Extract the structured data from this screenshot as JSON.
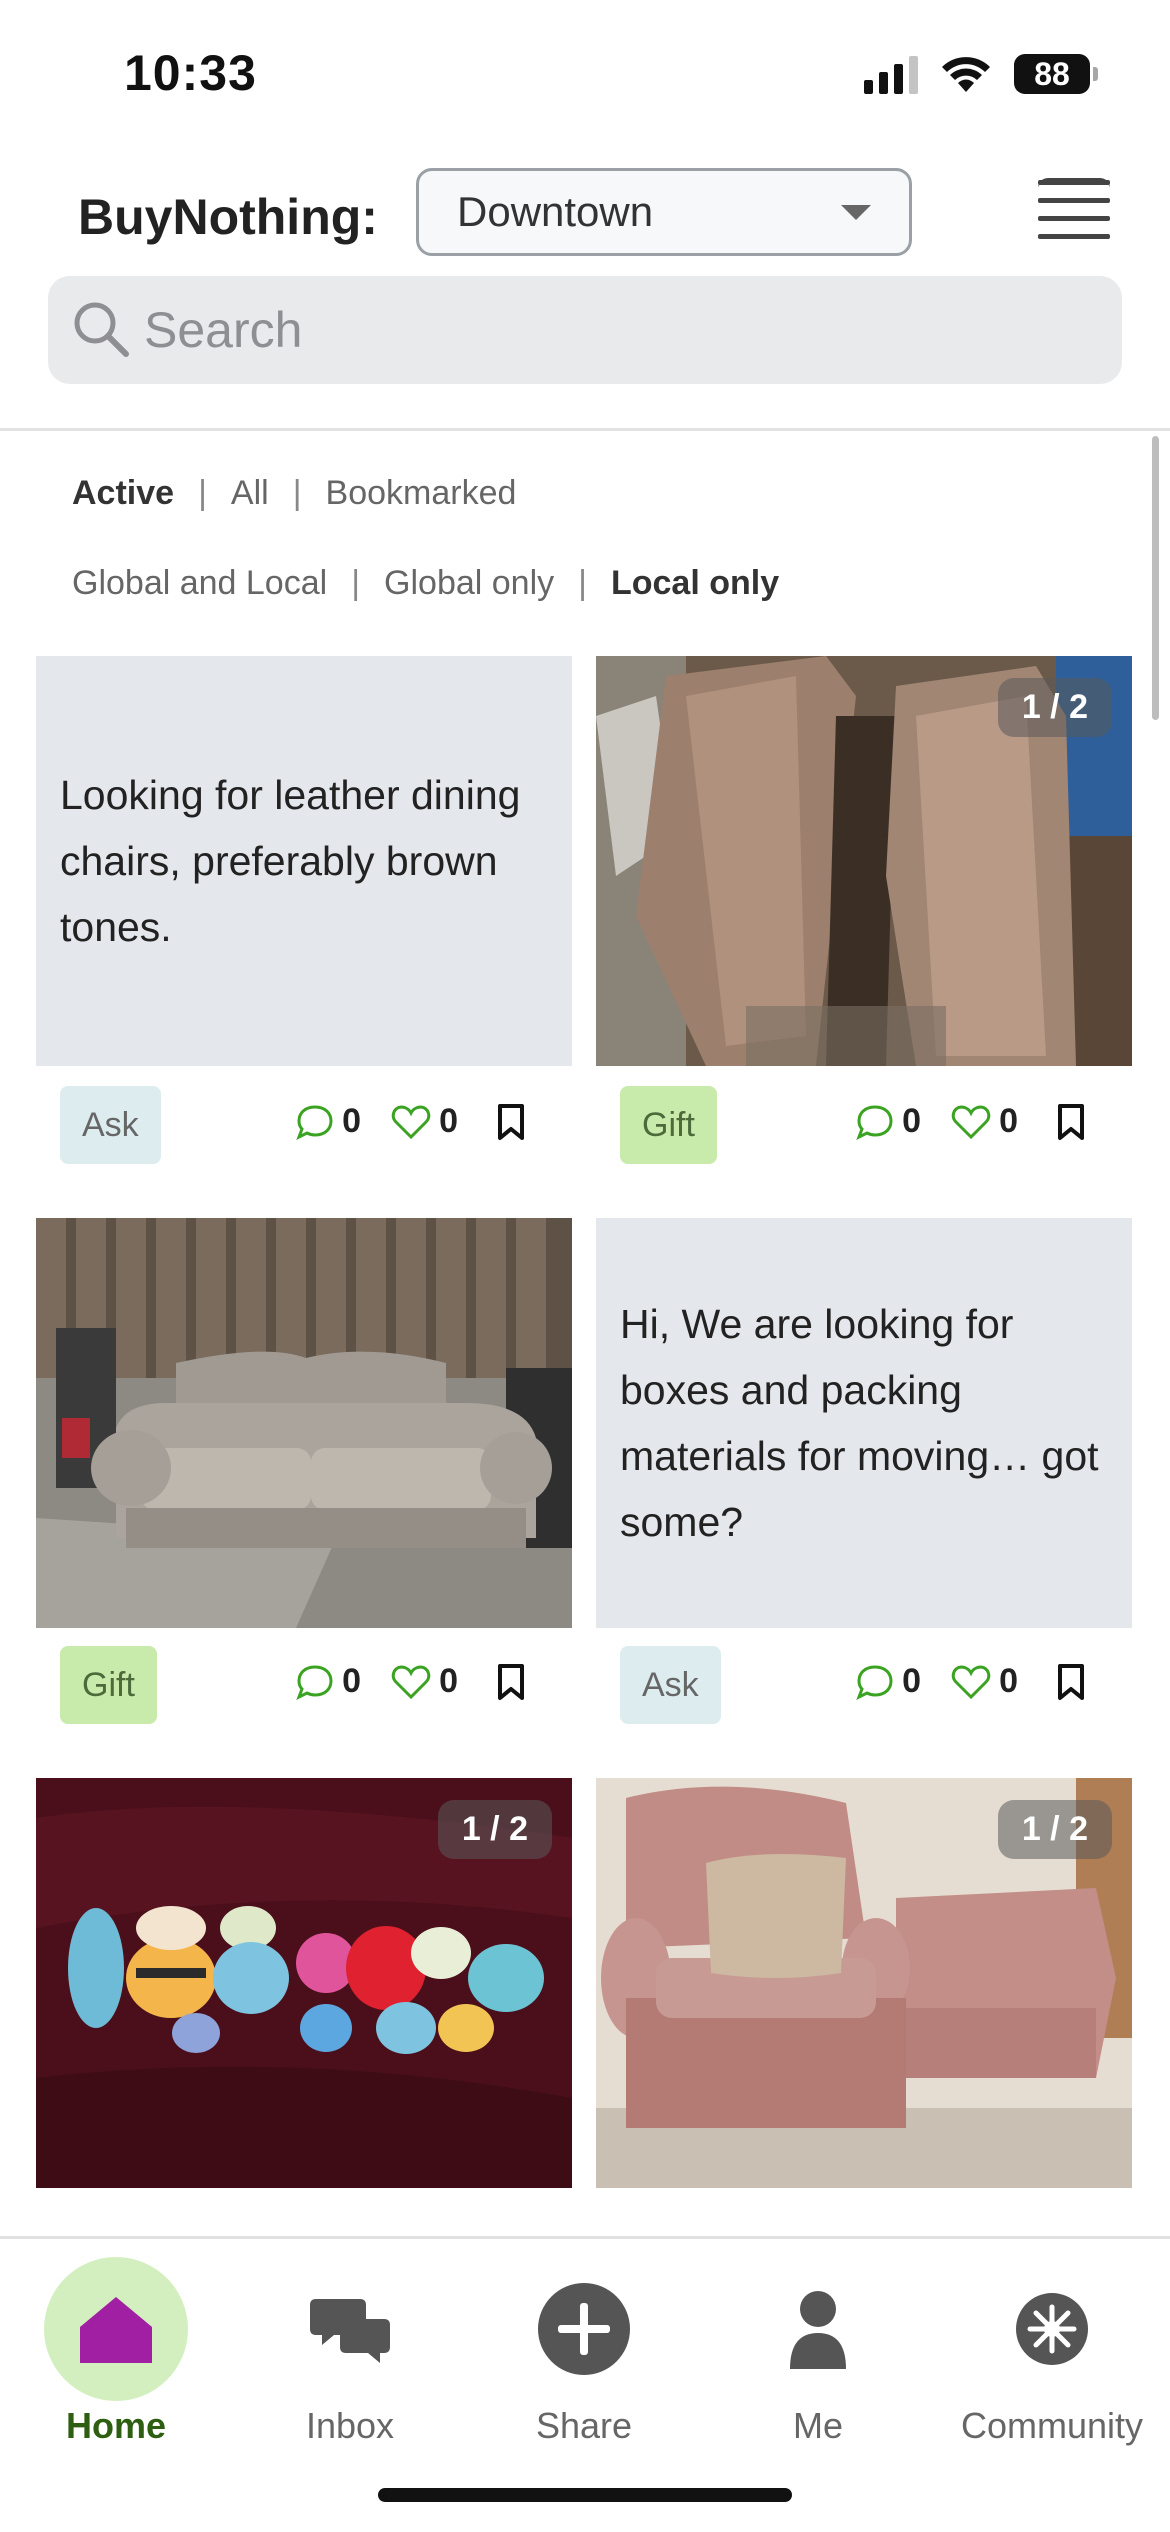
{
  "status_bar": {
    "time": "10:33",
    "battery": "88"
  },
  "header": {
    "brand": "BuyNothing:",
    "location": "Downtown"
  },
  "search": {
    "placeholder": "Search"
  },
  "filters": {
    "row1": [
      "Active",
      "All",
      "Bookmarked"
    ],
    "row2": [
      "Global and Local",
      "Global only",
      "Local only"
    ],
    "active_row1": "Active",
    "active_row2": "Local only"
  },
  "posts": [
    {
      "kind": "text",
      "text": "Looking for leather dining chairs, preferably brown tones.",
      "tag": "Ask",
      "comments": "0",
      "likes": "0"
    },
    {
      "kind": "photo",
      "photo": "pavers-stone-photo",
      "counter": "1 / 2",
      "tag": "Gift",
      "comments": "0",
      "likes": "0"
    },
    {
      "kind": "photo",
      "photo": "gray-loveseat-photo",
      "tag": "Gift",
      "comments": "0",
      "likes": "0"
    },
    {
      "kind": "text",
      "text": "Hi, We are looking for boxes  and packing materials for moving… got some?",
      "tag": "Ask",
      "comments": "0",
      "likes": "0"
    },
    {
      "kind": "photo",
      "photo": "crochet-plushies-photo",
      "counter": "1 / 2"
    },
    {
      "kind": "photo",
      "photo": "pink-armchair-photo",
      "counter": "1 / 2"
    }
  ],
  "nav": [
    {
      "label": "Home",
      "icon": "home-icon"
    },
    {
      "label": "Inbox",
      "icon": "chat-bubbles-icon"
    },
    {
      "label": "Share",
      "icon": "plus-circle-icon"
    },
    {
      "label": "Me",
      "icon": "person-icon"
    },
    {
      "label": "Community",
      "icon": "community-icon"
    }
  ],
  "colors": {
    "accent_green": "#2e5e12",
    "gift_tag": "#c8eaaa",
    "ask_tag": "#dcecef",
    "home_active": "#d3efbf",
    "home_icon": "#a11fa3"
  }
}
